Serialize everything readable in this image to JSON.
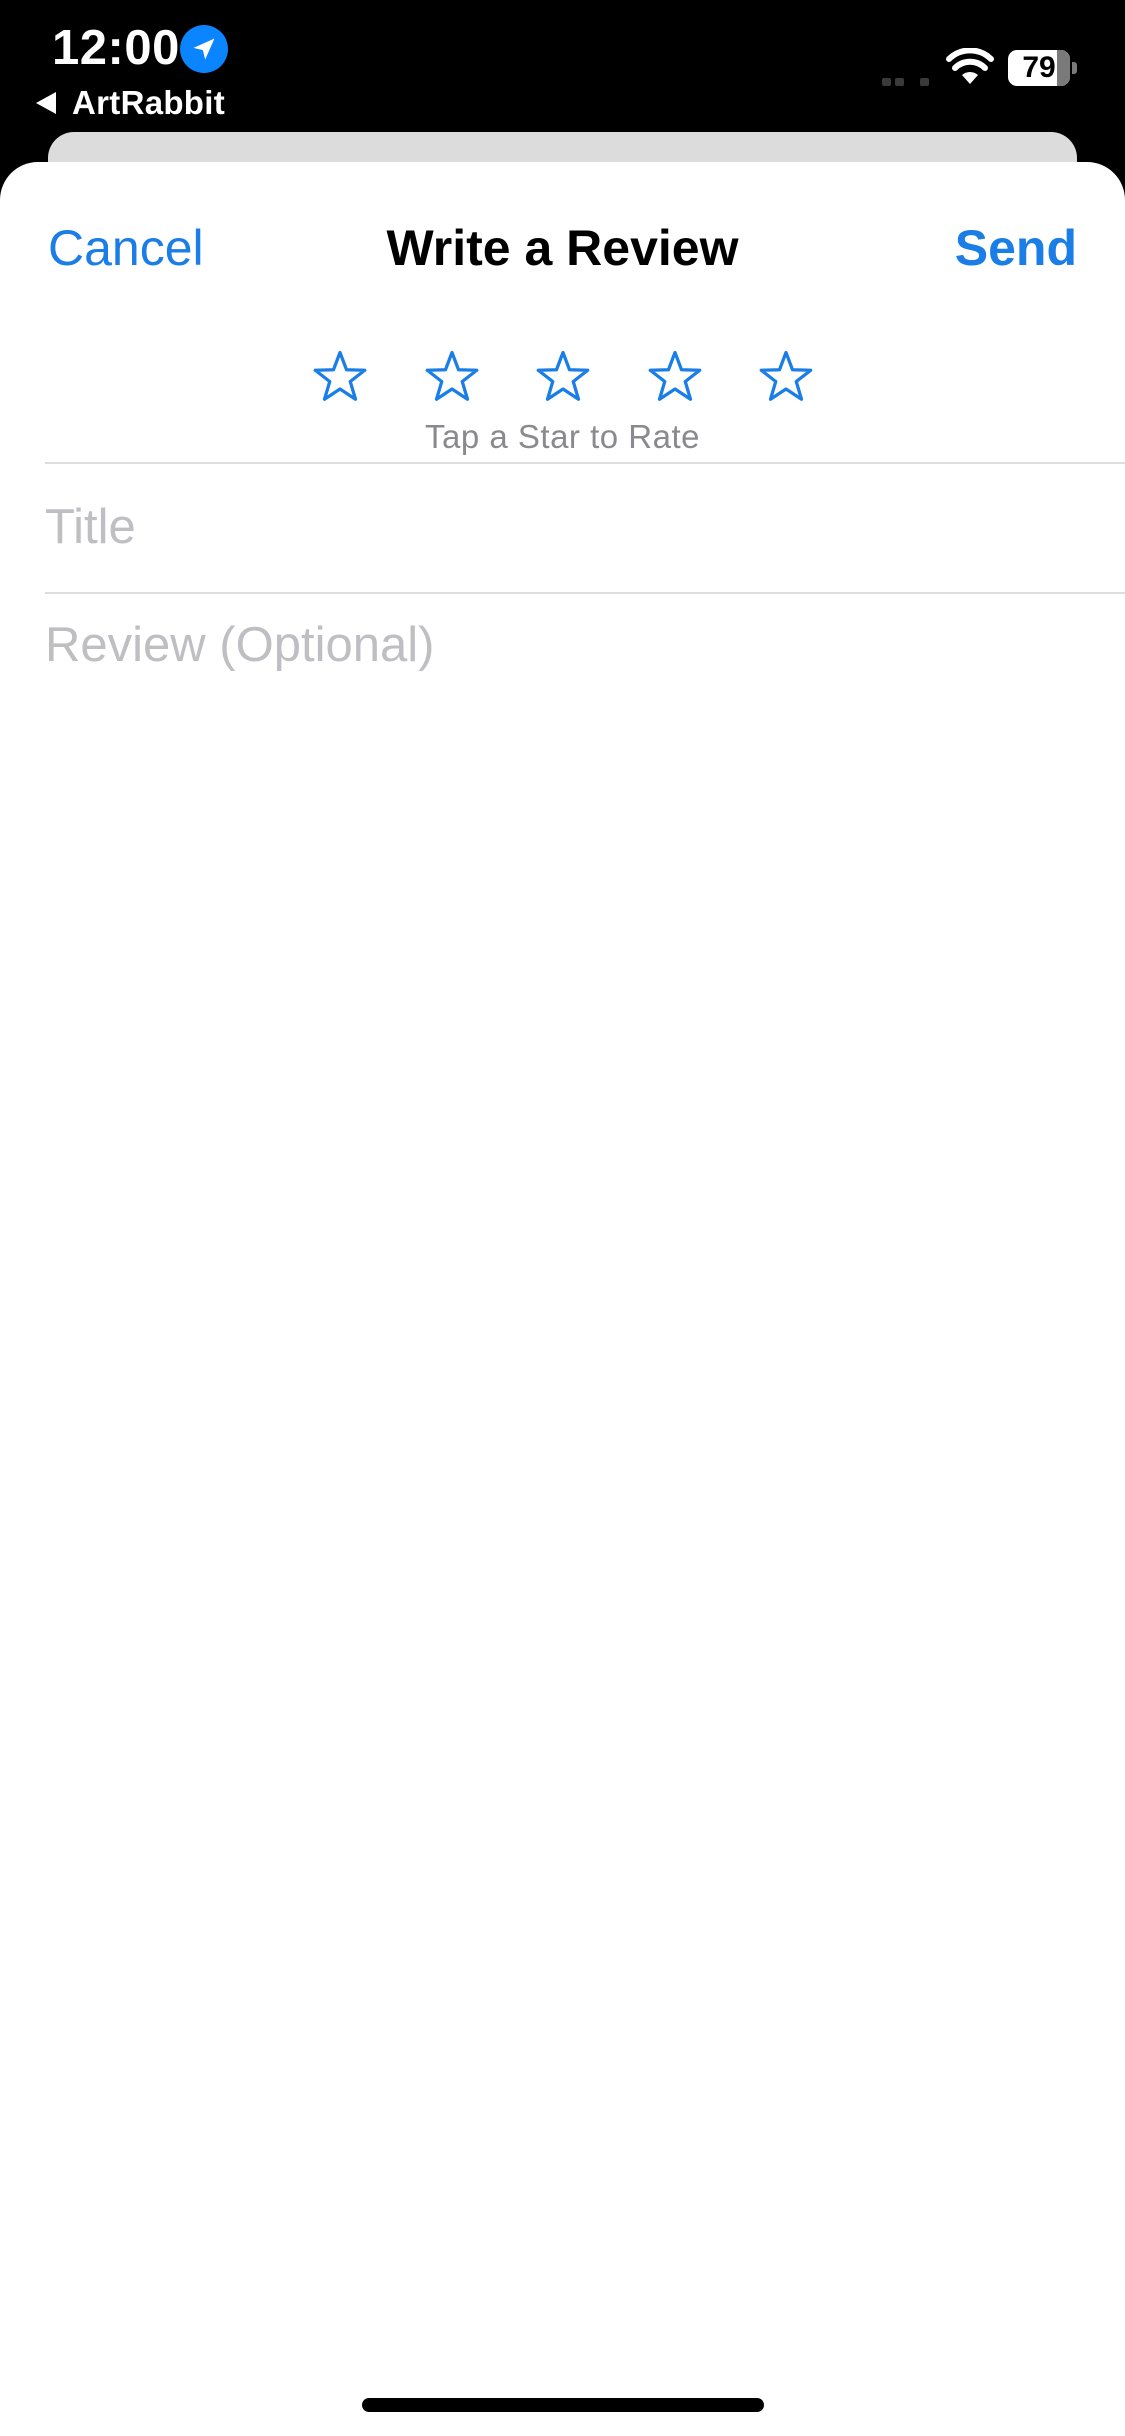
{
  "status_bar": {
    "time": "12:00",
    "back_app_label": "ArtRabbit",
    "battery_percent": "79",
    "battery_level": 0.79,
    "location_icon": "location-arrow-icon",
    "wifi_icon": "wifi-icon",
    "signal_icon": "cellular-signal-icon"
  },
  "nav": {
    "cancel_label": "Cancel",
    "title": "Write a Review",
    "send_label": "Send"
  },
  "rating": {
    "star_count": 5,
    "star_icon": "star-outline-icon",
    "hint": "Tap a Star to Rate"
  },
  "form": {
    "title_placeholder": "Title",
    "review_placeholder": "Review (Optional)"
  },
  "colors": {
    "accent": "#1a7ee6",
    "placeholder": "#bfbfc3",
    "hint": "#8a8a8e",
    "location_badge": "#0a84ff"
  }
}
